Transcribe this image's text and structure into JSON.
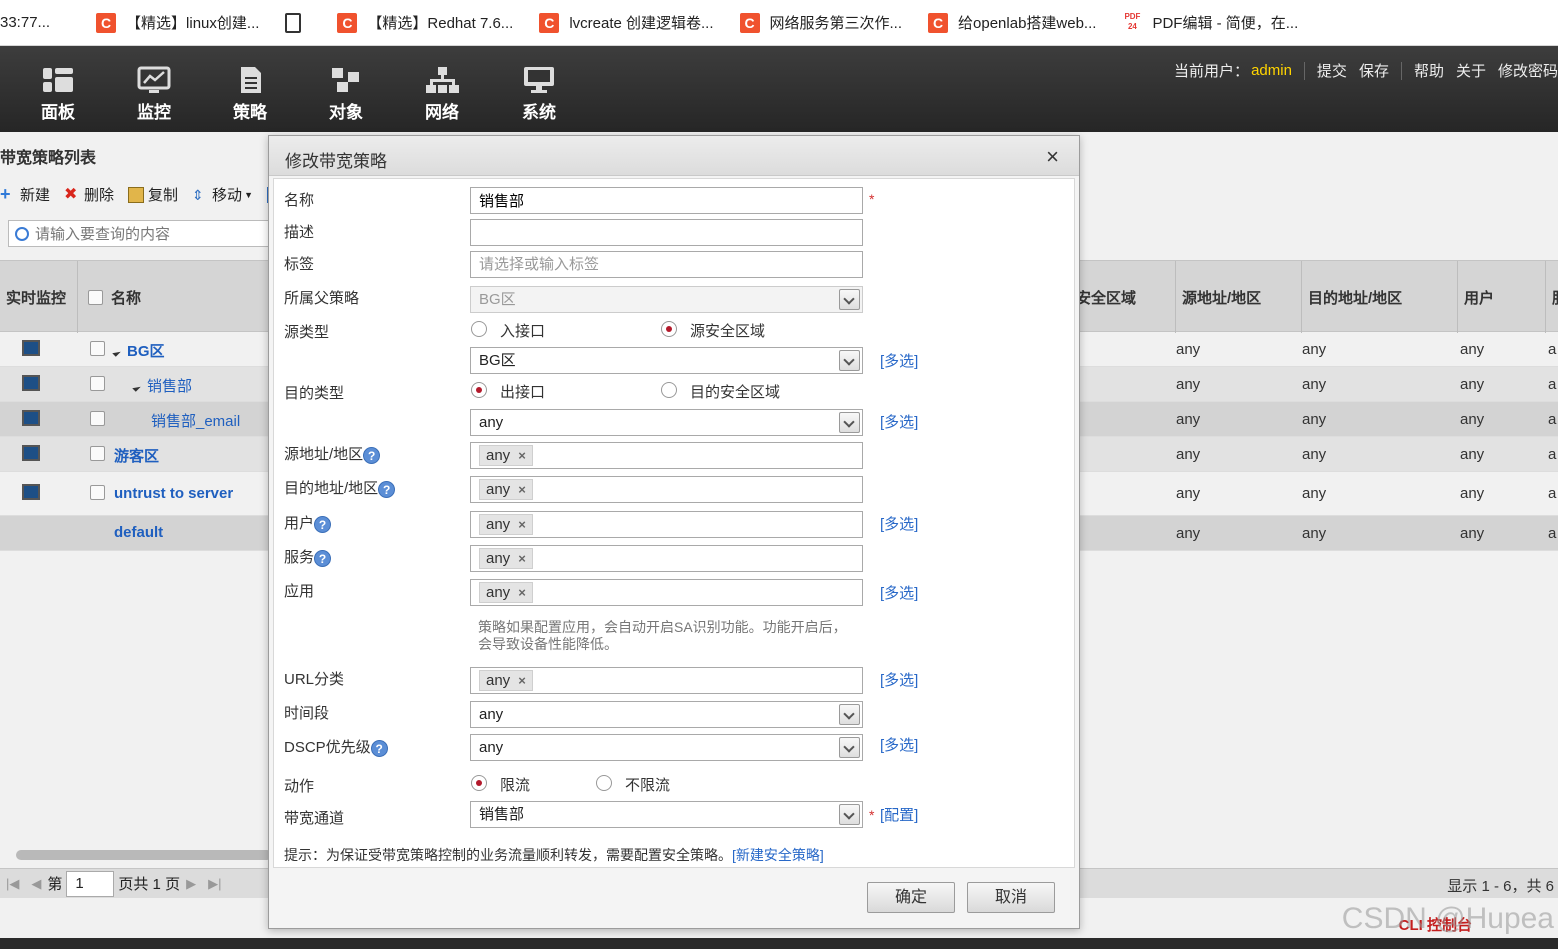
{
  "bookmarks": [
    {
      "label": "33:77...",
      "icon": "none"
    },
    {
      "label": "【精选】linux创建...",
      "icon": "csdn-icon"
    },
    {
      "label": "",
      "icon": "document-icon"
    },
    {
      "label": "【精选】Redhat 7.6...",
      "icon": "csdn-icon"
    },
    {
      "label": "lvcreate 创建逻辑卷...",
      "icon": "csdn-icon"
    },
    {
      "label": "网络服务第三次作...",
      "icon": "csdn-icon"
    },
    {
      "label": "给openlab搭建web...",
      "icon": "csdn-icon"
    },
    {
      "label": "PDF编辑 - 简便，在...",
      "icon": "pdf24-icon"
    }
  ],
  "nav": {
    "items": [
      {
        "label": "面板",
        "icon": "dashboard-icon"
      },
      {
        "label": "监控",
        "icon": "monitor-chart-icon"
      },
      {
        "label": "策略",
        "icon": "policy-doc-icon"
      },
      {
        "label": "对象",
        "icon": "objects-icon"
      },
      {
        "label": "网络",
        "icon": "network-icon"
      },
      {
        "label": "系统",
        "icon": "system-computer-icon"
      }
    ],
    "user_label": "当前用户：",
    "user_name": "admin",
    "links": [
      "提交",
      "保存",
      "帮助",
      "关于",
      "修改密码"
    ]
  },
  "list": {
    "title": "带宽策略列表",
    "toolbar": [
      "新建",
      "删除",
      "复制",
      "移动"
    ],
    "search_placeholder": "请输入要查询的内容",
    "headers": {
      "monitor": "实时监控",
      "name": "名称",
      "src_zone": "安全区域",
      "src_addr": "源地址/地区",
      "dst_addr": "目的地址/地区",
      "user": "用户",
      "more": "服"
    },
    "rows": [
      {
        "name": "BG区",
        "src_addr": "any",
        "dst_addr": "any",
        "user": "any",
        "more": "a"
      },
      {
        "name": "销售部",
        "src_addr": "any",
        "dst_addr": "any",
        "user": "any",
        "more": "a"
      },
      {
        "name": "销售部_email",
        "src_addr": "any",
        "dst_addr": "any",
        "user": "any",
        "more": "a"
      },
      {
        "name": "游客区",
        "src_addr": "any",
        "dst_addr": "any",
        "user": "any",
        "more": "a"
      },
      {
        "name": "untrust to server",
        "src_addr": "any",
        "dst_addr": "any",
        "user": "any",
        "more": "a"
      },
      {
        "name": "default",
        "src_addr": "any",
        "dst_addr": "any",
        "user": "any",
        "more": "a"
      }
    ],
    "pager": {
      "page_prefix": "第",
      "page": "1",
      "page_suffix": "页共 1 页",
      "summary": "显示 1 - 6，共 6"
    }
  },
  "modal": {
    "title": "修改带宽策略",
    "close": "×",
    "labels": {
      "name": "名称",
      "desc": "描述",
      "tag": "标签",
      "parent": "所属父策略",
      "src_type": "源类型",
      "dst_type": "目的类型",
      "src_addr": "源地址/地区",
      "dst_addr": "目的地址/地区",
      "user": "用户",
      "service": "服务",
      "app": "应用",
      "url": "URL分类",
      "time": "时间段",
      "dscp": "DSCP优先级",
      "action": "动作",
      "channel": "带宽通道"
    },
    "values": {
      "name": "销售部",
      "desc": "",
      "tag_placeholder": "请选择或输入标签",
      "parent": "BG区",
      "src_zone": "BG区",
      "dst_iface": "any",
      "src_addr_tag": "any",
      "dst_addr_tag": "any",
      "user_tag": "any",
      "service_tag": "any",
      "app_tag": "any",
      "url_tag": "any",
      "time": "any",
      "dscp": "any",
      "channel": "销售部"
    },
    "radios": {
      "src_in_iface": "入接口",
      "src_zone": "源安全区域",
      "dst_out_iface": "出接口",
      "dst_zone": "目的安全区域",
      "limit": "限流",
      "no_limit": "不限流"
    },
    "multi_select": "[多选]",
    "config_link": "[配置]",
    "required_mark": "*",
    "tag_remove": "×",
    "app_note": "策略如果配置应用，会自动开启SA识别功能。功能开启后，会导致设备性能降低。",
    "hint_text": "提示：为保证受带宽策略控制的业务流量顺利转发，需要配置安全策略。",
    "hint_link": "[新建安全策略]",
    "ok": "确定",
    "cancel": "取消"
  },
  "footer": {
    "cli": "CLI 控制台",
    "watermark": "CSDN @Hupea"
  },
  "colors": {
    "accent_link": "#2868c8",
    "admin_yellow": "#ffd400",
    "radio_selected": "#b3192b",
    "csdn_red": "#f0522e"
  }
}
